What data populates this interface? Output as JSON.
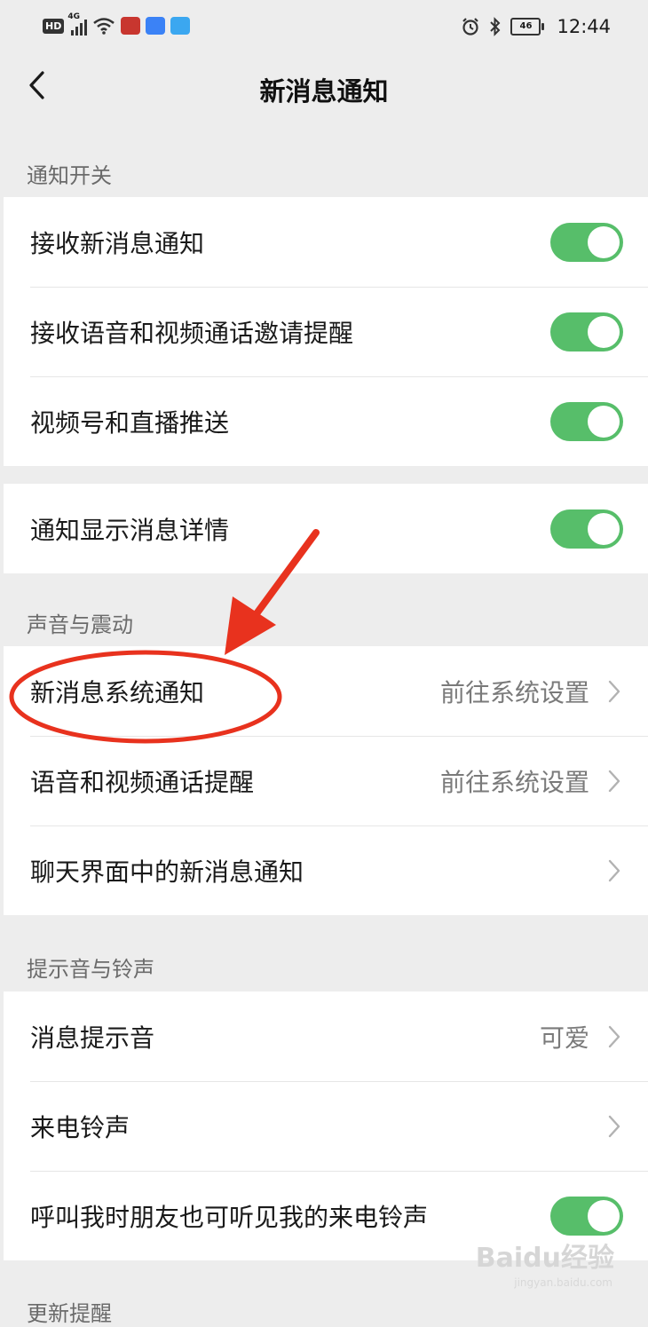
{
  "status_bar": {
    "hd": "HD",
    "network": "4G",
    "time": "12:44",
    "battery": "46",
    "icons": [
      "signal-icon",
      "wifi-icon",
      "app-icon",
      "cloud-icon",
      "search-app-icon",
      "alarm-icon",
      "bluetooth-icon",
      "battery-icon"
    ]
  },
  "header": {
    "title": "新消息通知",
    "back_icon": "chevron-left-icon"
  },
  "sections": [
    {
      "title": "通知开关",
      "groups": [
        [
          {
            "label": "接收新消息通知",
            "control": "toggle",
            "on": true
          },
          {
            "label": "接收语音和视频通话邀请提醒",
            "control": "toggle",
            "on": true
          },
          {
            "label": "视频号和直播推送",
            "control": "toggle",
            "on": true
          }
        ],
        [
          {
            "label": "通知显示消息详情",
            "control": "toggle",
            "on": true
          }
        ]
      ]
    },
    {
      "title": "声音与震动",
      "rows": [
        {
          "label": "新消息系统通知",
          "value": "前往系统设置",
          "control": "chevron"
        },
        {
          "label": "语音和视频通话提醒",
          "value": "前往系统设置",
          "control": "chevron"
        },
        {
          "label": "聊天界面中的新消息通知",
          "value": "",
          "control": "chevron"
        }
      ]
    },
    {
      "title": "提示音与铃声",
      "rows": [
        {
          "label": "消息提示音",
          "value": "可爱",
          "control": "chevron"
        },
        {
          "label": "来电铃声",
          "value": "",
          "control": "chevron"
        },
        {
          "label": "呼叫我时朋友也可听见我的来电铃声",
          "control": "toggle",
          "on": true
        }
      ]
    },
    {
      "title": "更新提醒"
    }
  ],
  "colors": {
    "background": "#ededed",
    "toggle_on": "#57be6a",
    "annotation_red": "#e8321e"
  },
  "watermark": {
    "text": "Baidu经验",
    "sub": "jingyan.baidu.com"
  }
}
